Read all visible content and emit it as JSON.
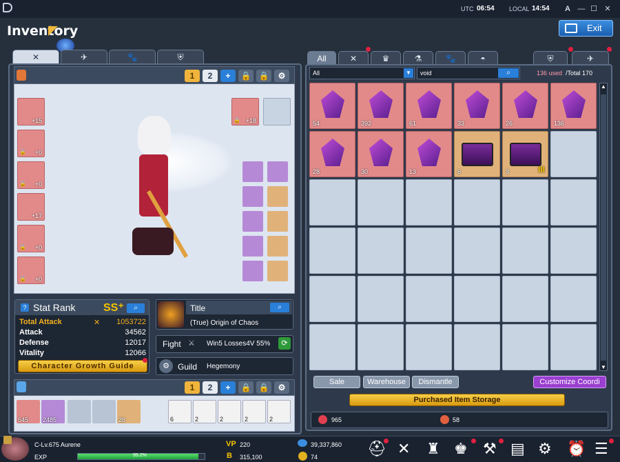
{
  "topbar": {
    "utc_label": "UTC",
    "utc_time": "06:54",
    "local_label": "LOCAL",
    "local_time": "14:54",
    "lang": "A"
  },
  "window": {
    "title": "Inventory",
    "exit_label": "Exit"
  },
  "left": {
    "page1": "1",
    "page2": "2",
    "stat": {
      "title": "Stat Rank",
      "rank": "SS⁺",
      "rows": [
        {
          "label": "Total Attack",
          "value": "1053722"
        },
        {
          "label": "Attack",
          "value": "34562"
        },
        {
          "label": "Defense",
          "value": "12017"
        },
        {
          "label": "Vitality",
          "value": "12066"
        }
      ],
      "guide_label": "Character Growth Guide"
    },
    "title_box": {
      "label": "Title",
      "value": "(True) Origin of Chaos"
    },
    "fight": {
      "label": "Fight",
      "value": "Win5 Losses4V 55%"
    },
    "guild": {
      "label": "Guild",
      "value": "Hegemony"
    },
    "left_equip": [
      "+15",
      "+0",
      "+0",
      "+17",
      "+0",
      "+0"
    ],
    "top_right_equip": "+18",
    "quick": {
      "page1": "1",
      "page2": "2",
      "items": [
        "545",
        "2485",
        "",
        "",
        "26"
      ],
      "emotes": [
        "6",
        "2",
        "2",
        "2",
        "2"
      ]
    }
  },
  "right": {
    "tabs": [
      "All"
    ],
    "filter": "All",
    "search_value": "void",
    "capacity_used": "136 used",
    "capacity_total": "/Total 170",
    "items": [
      {
        "qty": "54",
        "kind": "crystal"
      },
      {
        "qty": "392",
        "kind": "crystal"
      },
      {
        "qty": "61",
        "kind": "crystal"
      },
      {
        "qty": "33",
        "kind": "crystal"
      },
      {
        "qty": "26",
        "kind": "crystal"
      },
      {
        "qty": "136",
        "kind": "crystal"
      },
      {
        "qty": "28",
        "kind": "crystal"
      },
      {
        "qty": "30",
        "kind": "crystal"
      },
      {
        "qty": "13",
        "kind": "crystal"
      },
      {
        "qty": "6",
        "kind": "chest"
      },
      {
        "qty": "3",
        "kind": "chest3"
      }
    ],
    "grade_badge": "III",
    "buttons": {
      "sale": "Sale",
      "warehouse": "Warehouse",
      "dismantle": "Dismantle",
      "customize": "Customize Coordi"
    },
    "storage_label": "Purchased Item Storage",
    "currency1": "965",
    "currency2": "58"
  },
  "bottom": {
    "level": "C-Lv.675 Aurene",
    "exp_label": "EXP",
    "exp_pct": "95.2%",
    "exp_fill": 0.952,
    "vp_label": "VP",
    "vp": "220",
    "b_label": "B",
    "b": "315,100",
    "gp": "39,337,860",
    "coins": "74"
  },
  "colors": {
    "accent": "#2a7fd8",
    "item_red": "#e28a8a",
    "item_gold": "#e0b27a",
    "purple": "#9a3fd0"
  }
}
